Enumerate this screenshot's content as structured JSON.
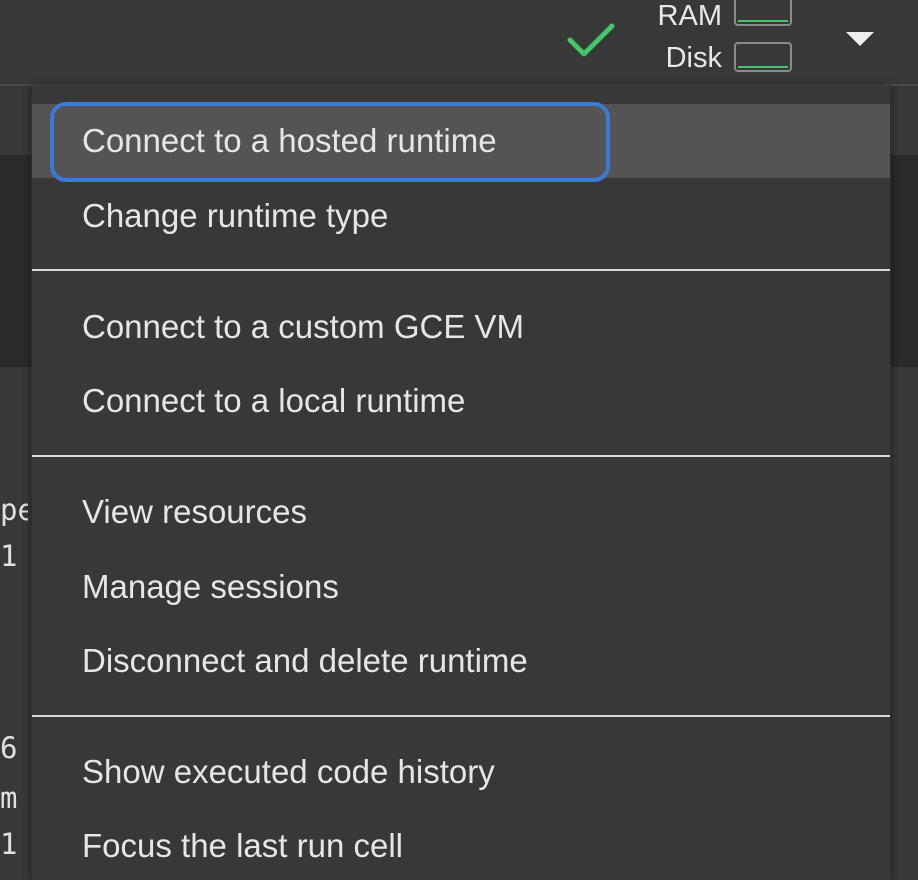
{
  "status": {
    "connected_icon": "check-icon",
    "ram_label": "RAM",
    "disk_label": "Disk",
    "dropdown_icon": "caret-down-icon",
    "accent_color": "#44c767"
  },
  "background": {
    "code_fragments": [
      "pe",
      "1",
      "6",
      "m",
      "1"
    ]
  },
  "menu": {
    "items": [
      {
        "label": "Connect to a hosted runtime"
      },
      {
        "label": "Change runtime type"
      },
      {
        "label": "Connect to a custom GCE VM"
      },
      {
        "label": "Connect to a local runtime"
      },
      {
        "label": "View resources"
      },
      {
        "label": "Manage sessions"
      },
      {
        "label": "Disconnect and delete runtime"
      },
      {
        "label": "Show executed code history"
      },
      {
        "label": "Focus the last run cell"
      }
    ],
    "highlight_color": "#3a7bd5"
  }
}
